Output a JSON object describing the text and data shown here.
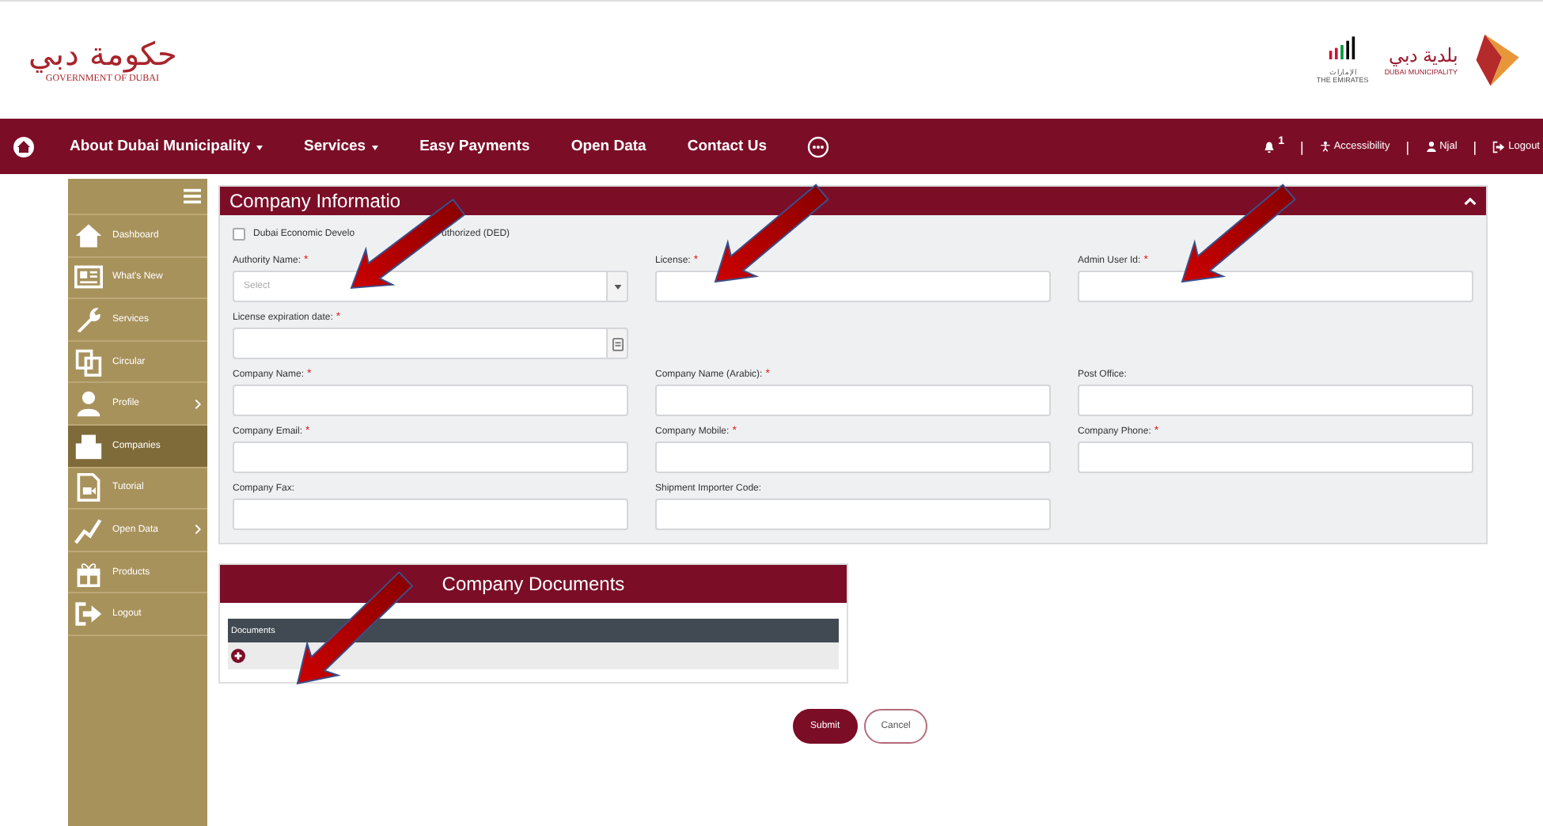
{
  "header": {
    "left_logo": {
      "arabic": "حكومة دبي",
      "english": "GOVERNMENT OF DUBAI"
    },
    "right_logos": {
      "emirates_arabic": "الإمارات",
      "emirates_english": "THE EMIRATES",
      "municipality_arabic": "بلدية دبي",
      "municipality_english": "DUBAI MUNICIPALITY"
    }
  },
  "nav": {
    "items": [
      {
        "label": "About Dubai Municipality",
        "dropdown": true
      },
      {
        "label": "Services",
        "dropdown": true
      },
      {
        "label": "Easy Payments",
        "dropdown": false
      },
      {
        "label": "Open Data",
        "dropdown": false
      },
      {
        "label": "Contact Us",
        "dropdown": false
      }
    ],
    "notifications": "1",
    "separator": "|",
    "links": [
      {
        "kind": "accessibility",
        "label": "Accessibility"
      },
      {
        "kind": "user",
        "label": "Njal"
      },
      {
        "kind": "logout",
        "label": "Logout"
      }
    ]
  },
  "sidebar": {
    "items": [
      {
        "label": "Dashboard",
        "selected": false,
        "submenu": false
      },
      {
        "label": "What's New",
        "selected": false,
        "submenu": false
      },
      {
        "label": "Services",
        "selected": false,
        "submenu": false
      },
      {
        "label": "Circular",
        "selected": false,
        "submenu": false
      },
      {
        "label": "Profile",
        "selected": false,
        "submenu": true
      },
      {
        "label": "Companies",
        "selected": true,
        "submenu": false
      },
      {
        "label": "Tutorial",
        "selected": false,
        "submenu": false
      },
      {
        "label": "Open Data",
        "selected": false,
        "submenu": true
      },
      {
        "label": "Products",
        "selected": false,
        "submenu": false
      },
      {
        "label": "Logout",
        "selected": false,
        "submenu": false
      }
    ]
  },
  "panel": {
    "title": "Company Informatio",
    "checkbox": {
      "label_start": "Dubai Economic Develo",
      "label_end": "uthorized (DED)",
      "checked": false
    },
    "rows": [
      [
        {
          "kind": "select",
          "label": "Authority Name:",
          "mark": "*",
          "placeholder": "Select"
        },
        {
          "kind": "text",
          "label": "License:",
          "mark": "*"
        },
        {
          "kind": "text",
          "label": "Admin User Id:",
          "mark": "*"
        }
      ],
      [
        {
          "kind": "date",
          "label": "License expiration date:",
          "mark": "*"
        }
      ],
      [
        {
          "kind": "text",
          "label": "Company Name:",
          "mark": "*"
        },
        {
          "kind": "text",
          "label": "Company Name (Arabic):",
          "mark": "*"
        },
        {
          "kind": "text",
          "label": "Post Office:"
        }
      ],
      [
        {
          "kind": "text",
          "label": "Company Email:",
          "mark": "*"
        },
        {
          "kind": "text",
          "label": "Company Mobile:",
          "mark": "*"
        },
        {
          "kind": "text",
          "label": "Company Phone:",
          "mark": "*"
        }
      ],
      [
        {
          "kind": "text",
          "label": "Company Fax:"
        },
        {
          "kind": "text",
          "label": "Shipment Importer Code:"
        }
      ]
    ]
  },
  "documents": {
    "title": "Company Documents",
    "column": "Documents"
  },
  "buttons": [
    {
      "kind": "primary",
      "label": "Submit"
    },
    {
      "kind": "secondary",
      "label": "Cancel"
    }
  ]
}
